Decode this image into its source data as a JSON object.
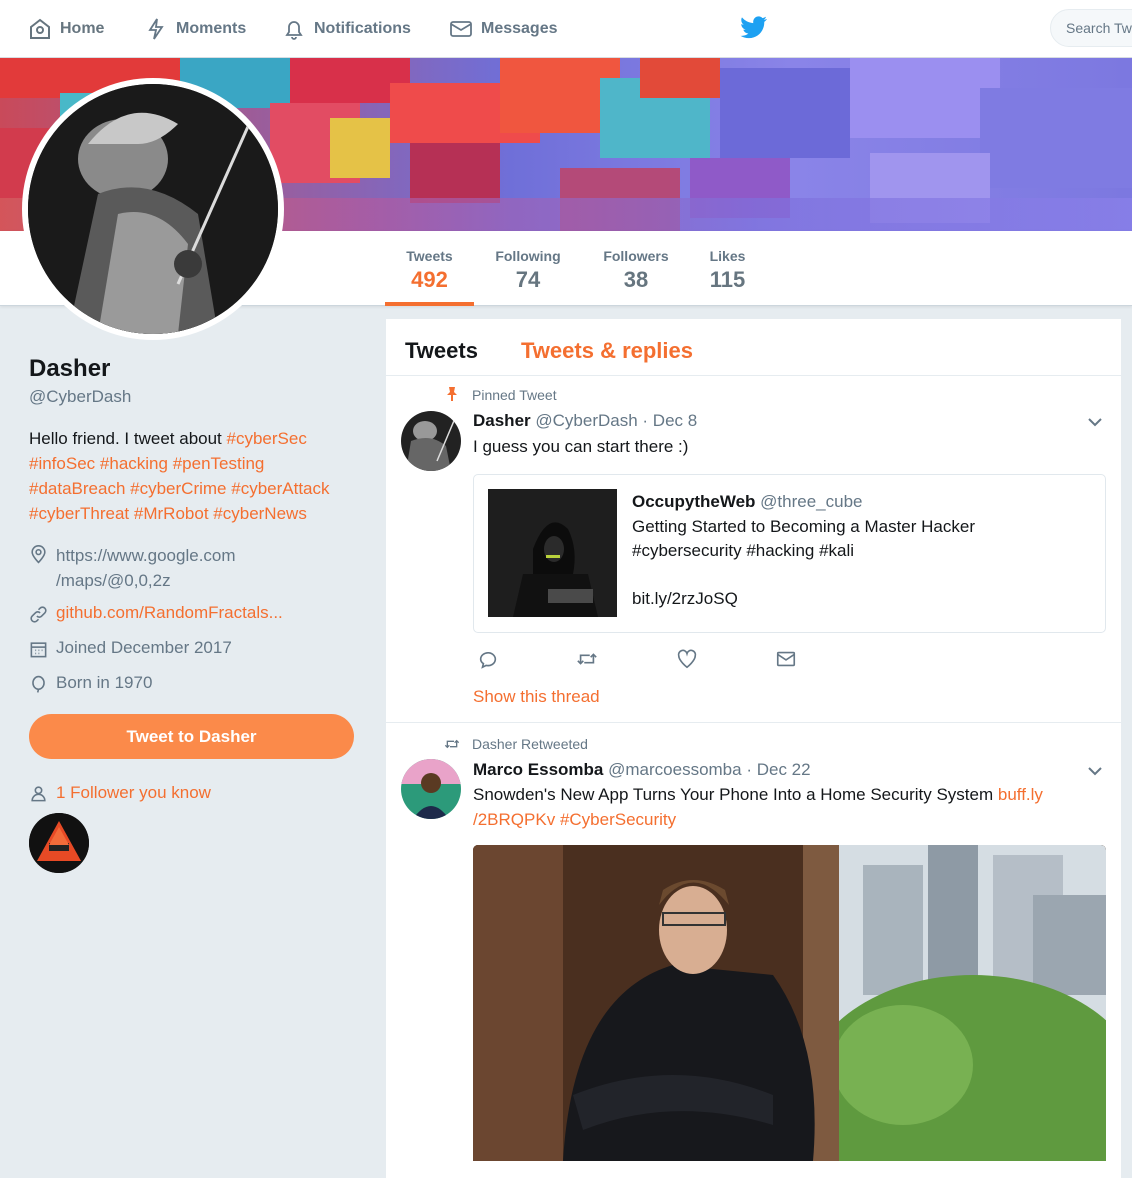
{
  "nav": {
    "home": "Home",
    "moments": "Moments",
    "notifications": "Notifications",
    "messages": "Messages",
    "search_placeholder": "Search Twitter",
    "brand_icon": "twitter-bird-icon"
  },
  "colors": {
    "accent": "#f46f30",
    "button": "#fb8a4a",
    "muted": "#657786",
    "background": "#e6ecf0"
  },
  "stats": [
    {
      "label": "Tweets",
      "value": "492"
    },
    {
      "label": "Following",
      "value": "74"
    },
    {
      "label": "Followers",
      "value": "38"
    },
    {
      "label": "Likes",
      "value": "115"
    }
  ],
  "profile": {
    "name": "Dasher",
    "handle": "@CyberDash",
    "bio_text": "Hello friend. I tweet about ",
    "bio_hashtags": [
      "#cyberSec",
      "#infoSec",
      "#hacking",
      "#penTesting",
      "#dataBreach",
      "#cyberCrime",
      "#cyberAttack",
      "#cyberThreat",
      "#MrRobot",
      "#cyberNews"
    ],
    "location_line1": "https://www.google.com",
    "location_line2": "/maps/@0,0,2z",
    "url": "github.com/RandomFractals...",
    "joined": "Joined December 2017",
    "born": "Born in 1970",
    "tweet_to_button": "Tweet to Dasher",
    "followers_you_know": "1 Follower you know"
  },
  "timeline": {
    "tabs": [
      "Tweets",
      "Tweets & replies"
    ],
    "tweets": [
      {
        "context": "Pinned Tweet",
        "name": "Dasher",
        "handle": "@CyberDash",
        "date": "· Dec 8",
        "text": "I guess you can start there :)",
        "card": {
          "name": "OccupytheWeb",
          "handle": "@three_cube",
          "line1": "Getting Started to  Becoming a Master Hacker",
          "line2": "#cybersecurity #hacking #kali",
          "line3": "bit.ly/2rzJoSQ"
        },
        "show_thread": "Show this thread"
      },
      {
        "context": "Dasher Retweeted",
        "name": "Marco Essomba",
        "handle": "@marcoessomba",
        "date": "· Dec 22",
        "text": "Snowden's New App Turns Your Phone Into a Home Security System ",
        "link1": "buff.ly",
        "link2": "/2BRQPKv",
        "hashtag": "#CyberSecurity"
      }
    ]
  }
}
